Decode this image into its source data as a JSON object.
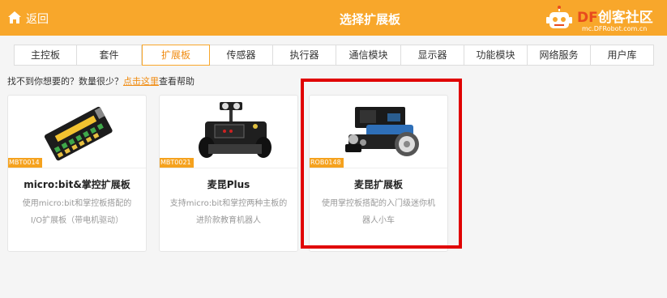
{
  "header": {
    "back_label": "返回",
    "title": "选择扩展板",
    "logo_prefix": "DF",
    "logo_suffix": "创客社区",
    "logo_url": "mc.DFRobot.com.cn",
    "color": "#f8a72b"
  },
  "tabs": [
    {
      "label": "主控板",
      "active": false
    },
    {
      "label": "套件",
      "active": false
    },
    {
      "label": "扩展板",
      "active": true
    },
    {
      "label": "传感器",
      "active": false
    },
    {
      "label": "执行器",
      "active": false
    },
    {
      "label": "通信模块",
      "active": false
    },
    {
      "label": "显示器",
      "active": false
    },
    {
      "label": "功能模块",
      "active": false
    },
    {
      "label": "网络服务",
      "active": false
    },
    {
      "label": "用户库",
      "active": false
    }
  ],
  "helper": {
    "prefix": "找不到你想要的？数量很少？",
    "link": "点击这里",
    "suffix": "查看帮助"
  },
  "cards": [
    {
      "sku": "MBT0014",
      "name": "micro:bit&掌控扩展板",
      "desc": "使用micro:bit和掌控板搭配的I/O扩展板（带电机驱动）"
    },
    {
      "sku": "MBT0021",
      "name": "麦昆Plus",
      "desc": "支持micro:bit和掌控两种主板的进阶款教育机器人"
    },
    {
      "sku": "ROB0148",
      "name": "麦昆扩展板",
      "desc": "使用掌控板搭配的入门级迷你机器人小车",
      "highlighted": true
    }
  ],
  "colors": {
    "accent": "#f8a72b",
    "link": "#f08c12",
    "highlight": "#e00000"
  }
}
